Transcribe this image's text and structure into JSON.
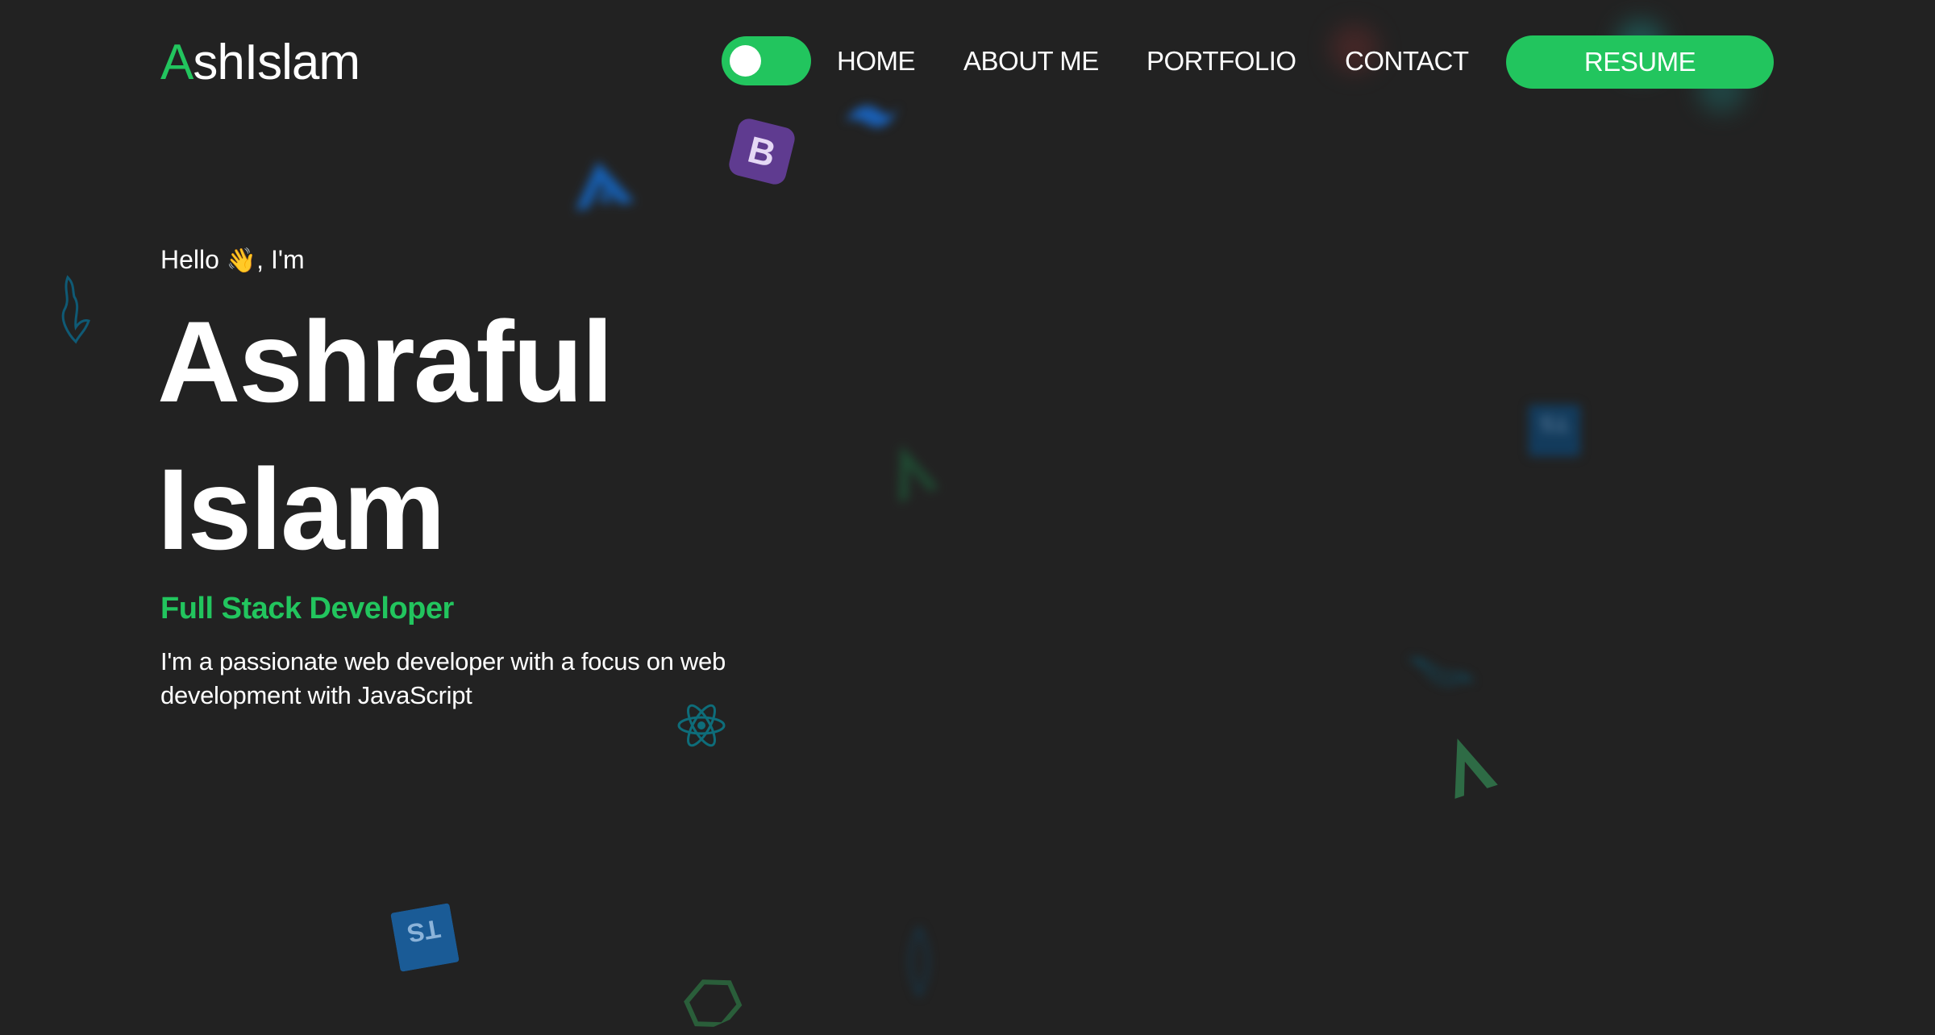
{
  "header": {
    "logo": {
      "accent": "A",
      "rest": "shIslam"
    },
    "theme_toggle": {
      "state": "on"
    },
    "nav": [
      {
        "label": "HOME"
      },
      {
        "label": "ABOUT ME"
      },
      {
        "label": "PORTFOLIO"
      },
      {
        "label": "CONTACT"
      }
    ],
    "resume_label": "RESUME"
  },
  "hero": {
    "greeting_prefix": "Hello ",
    "greeting_emoji": "👋",
    "greeting_suffix": ", I'm",
    "name_first": "Ashraful",
    "name_last": "Islam",
    "role": "Full Stack Developer",
    "bio": "I'm a passionate web developer with a focus on web development with JavaScript"
  },
  "background_icons": [
    {
      "icon": "bootstrap-icon",
      "text": "B"
    },
    {
      "icon": "typescript-icon",
      "text": "TS"
    },
    {
      "icon": "typescript-icon",
      "text": "TS"
    },
    {
      "icon": "react-icon"
    },
    {
      "icon": "vue-icon"
    },
    {
      "icon": "vue-icon"
    },
    {
      "icon": "mysql-dolphin-icon"
    },
    {
      "icon": "mysql-dolphin-icon"
    },
    {
      "icon": "angular-icon"
    },
    {
      "icon": "tailwind-icon"
    },
    {
      "icon": "mongodb-leaf-icon"
    },
    {
      "icon": "nodejs-icon"
    }
  ],
  "colors": {
    "background": "#222222",
    "accent": "#22c55e",
    "text": "#ffffff"
  }
}
